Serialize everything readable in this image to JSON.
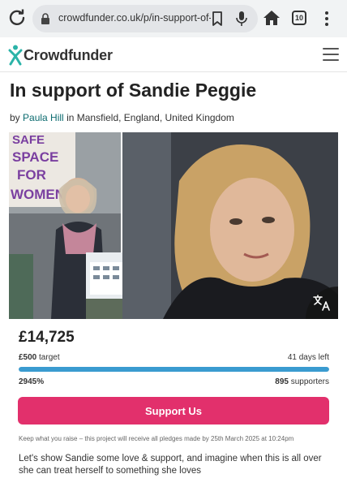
{
  "browser": {
    "url": "crowdfunder.co.uk/p/in-support-of-",
    "tab_count": "10"
  },
  "site": {
    "logo_text": "Crowdfunder"
  },
  "project": {
    "title": "In support of Sandie Peggie",
    "by_prefix": "by",
    "author": "Paula Hill",
    "in_word": "in",
    "location": "Mansfield, England, United Kingdom",
    "hero_sign_text": [
      "SAFE",
      "SPACE",
      "FOR",
      "WOMEN"
    ],
    "raised": "£14,725",
    "target_amount": "£500",
    "target_label": "target",
    "days_left": "41 days left",
    "percent": "2945%",
    "progress_fraction": 1.0,
    "supporters_count": "895",
    "supporters_label": "supporters",
    "support_button": "Support Us",
    "pledge_note": "Keep what you raise – this project will receive all pledges made by 25th March 2025 at 10:24pm",
    "story": "Let's show Sandie some love & support, and imagine when this is all over she can treat herself to something she loves"
  },
  "colors": {
    "brand_teal": "#2bb3a8",
    "support_button": "#e2306c",
    "progress": "#3a9bd0"
  }
}
